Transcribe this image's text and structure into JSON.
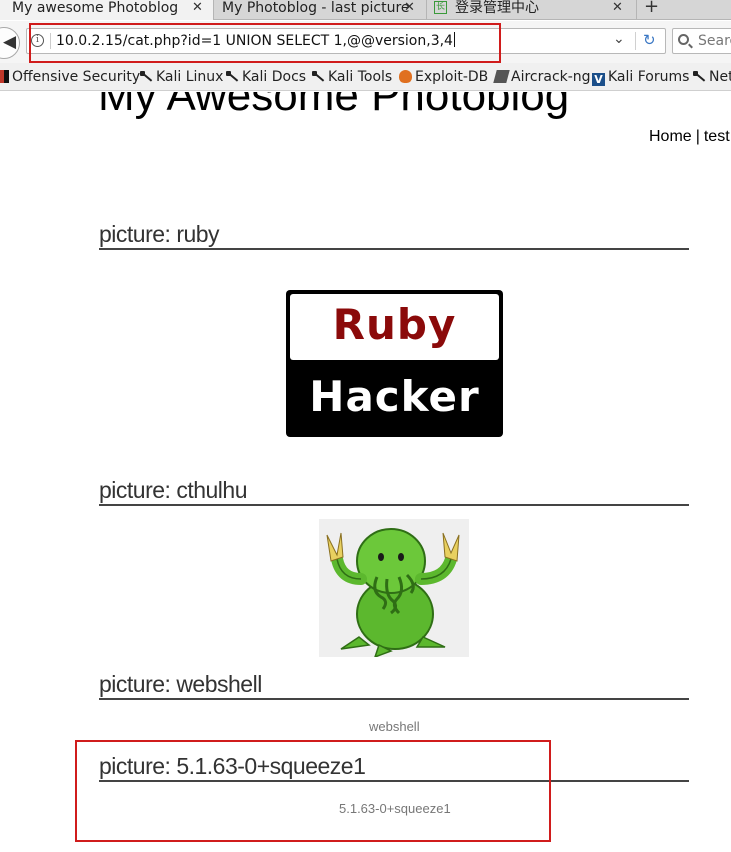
{
  "tabs": [
    {
      "title": "My awesome Photoblog",
      "close": "✕"
    },
    {
      "title": "My Photoblog - last picture",
      "close": "✕"
    },
    {
      "title": "登录管理中心",
      "favicon": "长",
      "close": "✕"
    }
  ],
  "new_tab": "+",
  "navbar": {
    "url": "10.0.2.15/cat.php?id=1 UNION SELECT 1,@@version,3,4",
    "search_placeholder": "Search",
    "icons": [
      "back-arrow-icon",
      "info-icon",
      "dropdown-chevron-icon",
      "reload-icon",
      "search-icon"
    ]
  },
  "bookmarks": [
    {
      "label": "Offensive Security",
      "icon": "offsec-icon"
    },
    {
      "label": "Kali Linux",
      "icon": "kali-dragon-icon"
    },
    {
      "label": "Kali Docs",
      "icon": "kali-dragon-icon"
    },
    {
      "label": "Kali Tools",
      "icon": "kali-dragon-icon"
    },
    {
      "label": "Exploit-DB",
      "icon": "exploitdb-icon"
    },
    {
      "label": "Aircrack-ng",
      "icon": "aircrack-icon"
    },
    {
      "label": "Kali Forums",
      "icon": "kali-forums-icon"
    },
    {
      "label": "NetH",
      "icon": "kali-dragon-icon"
    }
  ],
  "page": {
    "site_title": "My Awesome Photoblog",
    "nav": {
      "home": "Home",
      "separator": "|",
      "test": "test"
    },
    "pictures": [
      {
        "heading": "picture: ruby",
        "logo_line1": "Ruby",
        "logo_line2": "Hacker"
      },
      {
        "heading": "picture: cthulhu"
      },
      {
        "heading": "picture: webshell",
        "caption": "webshell"
      },
      {
        "heading": "picture: 5.1.63-0+squeeze1",
        "caption": "5.1.63-0+squeeze1"
      }
    ]
  },
  "colors": {
    "annotation_red": "#d01c1c",
    "ruby_red": "#8b0a0a",
    "cthulhu_green": "#5cb82e"
  }
}
